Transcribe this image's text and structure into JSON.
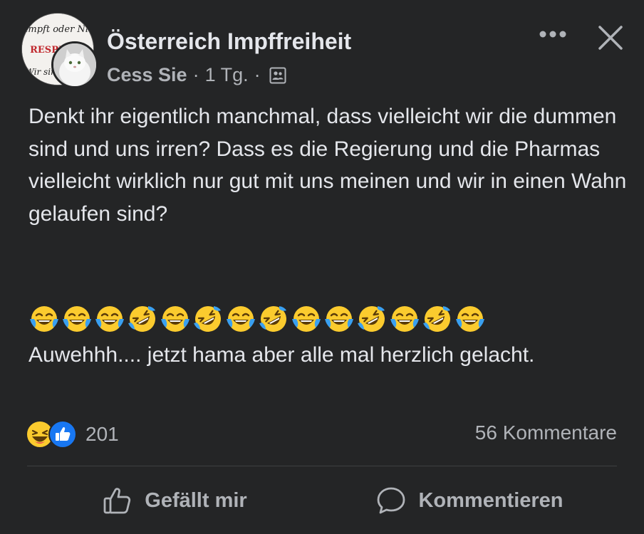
{
  "header": {
    "group_name": "Österreich Impffreiheit",
    "author": "Cess Sie",
    "separator": "·",
    "time": "1 Tg.",
    "audience_icon": "group-audience-icon",
    "avatar_text_top": "Geimpft oder Nicht",
    "avatar_text_mid": "RESPE",
    "avatar_text_bottom": "Wir sind"
  },
  "post": {
    "text": "Denkt ihr eigentlich manchmal, dass vielleicht wir die dummen sind und uns irren? Dass es die Regierung und die Pharmas vielleicht wirklich nur gut mit uns meinen und wir in einen Wahn gelaufen sind?",
    "emojis": [
      "tears-of-joy",
      "tears-of-joy",
      "tears-of-joy",
      "rolling-laughing",
      "tears-of-joy",
      "rolling-laughing",
      "tears-of-joy",
      "rolling-laughing",
      "tears-of-joy",
      "tears-of-joy",
      "rolling-laughing",
      "tears-of-joy",
      "rolling-laughing",
      "tears-of-joy"
    ],
    "text_2": "Auwehhh.... jetzt hama aber alle mal herzlich gelacht."
  },
  "stats": {
    "reaction_count": "201",
    "comment_count": "56 Kommentare",
    "reaction_icons": [
      "haha-icon",
      "like-icon"
    ]
  },
  "actions": {
    "like_label": "Gefällt mir",
    "comment_label": "Kommentieren"
  },
  "colors": {
    "background": "#242526",
    "text": "#e4e6eb",
    "secondary": "#b0b3b8",
    "like_blue": "#1877f2",
    "emoji_yellow": "#fbcb2e"
  }
}
